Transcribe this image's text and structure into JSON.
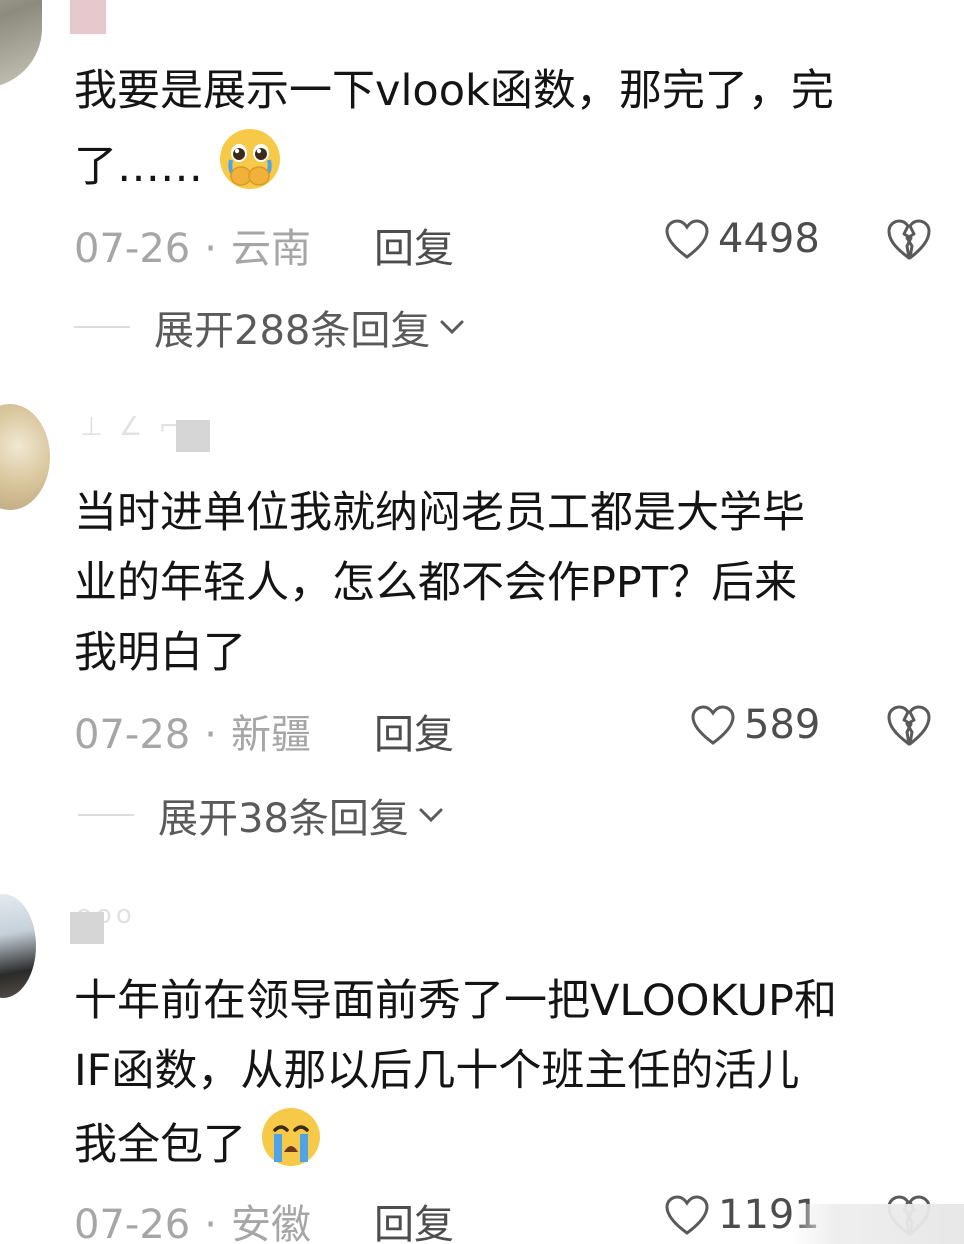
{
  "comments": [
    {
      "text_line1": "我要是展示一下vlook函数，那完了，完",
      "text_line2": "了……",
      "emoji": "pleading-face-hands-emoji",
      "date": "07-26",
      "location": "云南",
      "reply_label": "回复",
      "likes": "4498",
      "expand_label": "展开288条回复"
    },
    {
      "author_hint": "⊥ ∠ ⌐",
      "text_line1": "当时进单位我就纳闷老员工都是大学毕",
      "text_line2": "业的年轻人，怎么都不会作PPT？后来",
      "text_line3": "我明白了",
      "date": "07-28",
      "location": "新疆",
      "reply_label": "回复",
      "likes": "589",
      "expand_label": "展开38条回复"
    },
    {
      "author_hint": "ooo",
      "text_line1": "十年前在领导面前秀了一把VLOOKUP和",
      "text_line2": "IF函数，从那以后几十个班主任的活儿",
      "text_line3": "我全包了",
      "emoji": "crying-face-emoji",
      "date": "07-26",
      "location": "安徽",
      "reply_label": "回复",
      "likes": "1191"
    }
  ],
  "separator": "·",
  "colors": {
    "text": "#141414",
    "meta": "#a6a6a6",
    "action": "#4d4d4d",
    "emoji_yellow": "#f7c948",
    "tear_blue": "#4fa3e8"
  }
}
